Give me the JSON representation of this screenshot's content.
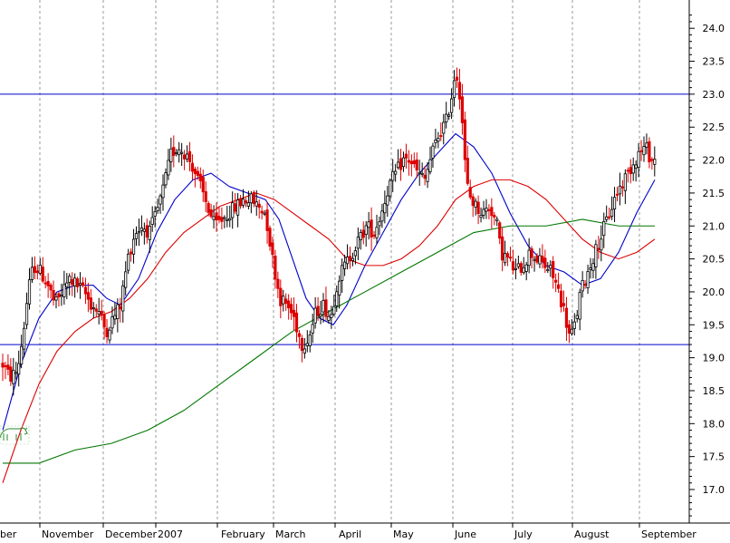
{
  "chart_data": {
    "type": "candlestick",
    "title": "",
    "xlabel": "",
    "ylabel": "",
    "ylim": [
      16.6,
      24.3
    ],
    "y_ticks": [
      17.0,
      17.5,
      18.0,
      18.5,
      19.0,
      19.5,
      20.0,
      20.5,
      21.0,
      21.5,
      22.0,
      22.5,
      23.0,
      23.5,
      24.0
    ],
    "y_axis_side": "right",
    "x_labels": [
      "ber",
      "November",
      "December",
      "2007",
      "February",
      "March",
      "April",
      "May",
      "June",
      "July",
      "August",
      "September"
    ],
    "grid": "vertical dotted at month boundaries",
    "horizontal_lines": [
      {
        "value": 23.0,
        "color": "#0000cc"
      },
      {
        "value": 19.2,
        "color": "#0000cc"
      }
    ],
    "anchors": [
      [
        0,
        18.9
      ],
      [
        8,
        18.7
      ],
      [
        16,
        18.8
      ],
      [
        22,
        19.3
      ],
      [
        28,
        20.0
      ],
      [
        34,
        20.4
      ],
      [
        42,
        20.3
      ],
      [
        50,
        20.1
      ],
      [
        58,
        19.8
      ],
      [
        66,
        20.0
      ],
      [
        74,
        20.2
      ],
      [
        82,
        20.1
      ],
      [
        90,
        20.0
      ],
      [
        98,
        19.8
      ],
      [
        106,
        19.7
      ],
      [
        114,
        19.4
      ],
      [
        122,
        19.6
      ],
      [
        130,
        19.8
      ],
      [
        138,
        20.5
      ],
      [
        146,
        20.9
      ],
      [
        154,
        21.0
      ],
      [
        162,
        20.9
      ],
      [
        170,
        21.2
      ],
      [
        178,
        21.6
      ],
      [
        186,
        22.1
      ],
      [
        194,
        22.2
      ],
      [
        202,
        22.1
      ],
      [
        210,
        21.9
      ],
      [
        218,
        21.6
      ],
      [
        226,
        21.3
      ],
      [
        234,
        21.0
      ],
      [
        242,
        21.1
      ],
      [
        250,
        21.2
      ],
      [
        258,
        21.3
      ],
      [
        266,
        21.4
      ],
      [
        274,
        21.4
      ],
      [
        282,
        21.3
      ],
      [
        290,
        21.2
      ],
      [
        298,
        20.5
      ],
      [
        306,
        19.9
      ],
      [
        314,
        19.8
      ],
      [
        322,
        19.6
      ],
      [
        330,
        19.2
      ],
      [
        338,
        19.3
      ],
      [
        346,
        19.7
      ],
      [
        354,
        19.8
      ],
      [
        362,
        19.6
      ],
      [
        370,
        20.2
      ],
      [
        378,
        20.4
      ],
      [
        386,
        20.6
      ],
      [
        394,
        20.8
      ],
      [
        402,
        21.0
      ],
      [
        410,
        20.9
      ],
      [
        418,
        21.2
      ],
      [
        426,
        21.6
      ],
      [
        434,
        21.8
      ],
      [
        442,
        22.0
      ],
      [
        450,
        22.0
      ],
      [
        458,
        21.8
      ],
      [
        466,
        21.7
      ],
      [
        474,
        22.1
      ],
      [
        482,
        22.4
      ],
      [
        490,
        22.6
      ],
      [
        496,
        23.0
      ],
      [
        500,
        23.4
      ],
      [
        506,
        22.9
      ],
      [
        510,
        22.0
      ],
      [
        514,
        21.5
      ],
      [
        522,
        21.3
      ],
      [
        530,
        21.2
      ],
      [
        538,
        21.3
      ],
      [
        546,
        21.0
      ],
      [
        550,
        20.6
      ],
      [
        558,
        20.5
      ],
      [
        566,
        20.3
      ],
      [
        574,
        20.4
      ],
      [
        582,
        20.6
      ],
      [
        590,
        20.5
      ],
      [
        598,
        20.4
      ],
      [
        606,
        20.3
      ],
      [
        614,
        20.0
      ],
      [
        620,
        19.7
      ],
      [
        626,
        19.3
      ],
      [
        632,
        19.5
      ],
      [
        638,
        20.0
      ],
      [
        646,
        20.3
      ],
      [
        654,
        20.6
      ],
      [
        662,
        20.9
      ],
      [
        670,
        21.2
      ],
      [
        678,
        21.5
      ],
      [
        686,
        21.7
      ],
      [
        694,
        21.9
      ],
      [
        702,
        22.1
      ],
      [
        710,
        22.2
      ],
      [
        716,
        22.0
      ],
      [
        722,
        22.0
      ]
    ],
    "moving_averages": [
      {
        "color": "#0000cc",
        "values": [
          [
            0,
            17.9
          ],
          [
            20,
            18.9
          ],
          [
            40,
            19.6
          ],
          [
            60,
            20.0
          ],
          [
            80,
            20.1
          ],
          [
            100,
            20.1
          ],
          [
            115,
            19.9
          ],
          [
            130,
            19.8
          ],
          [
            150,
            20.2
          ],
          [
            170,
            20.9
          ],
          [
            190,
            21.4
          ],
          [
            210,
            21.7
          ],
          [
            230,
            21.8
          ],
          [
            250,
            21.6
          ],
          [
            270,
            21.5
          ],
          [
            290,
            21.4
          ],
          [
            305,
            21.1
          ],
          [
            320,
            20.5
          ],
          [
            335,
            19.9
          ],
          [
            350,
            19.6
          ],
          [
            365,
            19.5
          ],
          [
            380,
            19.8
          ],
          [
            400,
            20.4
          ],
          [
            420,
            20.9
          ],
          [
            440,
            21.4
          ],
          [
            460,
            21.8
          ],
          [
            480,
            22.1
          ],
          [
            500,
            22.4
          ],
          [
            520,
            22.2
          ],
          [
            540,
            21.8
          ],
          [
            560,
            21.2
          ],
          [
            580,
            20.7
          ],
          [
            600,
            20.4
          ],
          [
            620,
            20.3
          ],
          [
            640,
            20.1
          ],
          [
            660,
            20.2
          ],
          [
            680,
            20.6
          ],
          [
            700,
            21.2
          ],
          [
            720,
            21.7
          ]
        ]
      },
      {
        "color": "#dd0000",
        "values": [
          [
            0,
            17.1
          ],
          [
            20,
            17.9
          ],
          [
            40,
            18.6
          ],
          [
            60,
            19.1
          ],
          [
            80,
            19.4
          ],
          [
            100,
            19.6
          ],
          [
            120,
            19.7
          ],
          [
            140,
            19.9
          ],
          [
            160,
            20.2
          ],
          [
            180,
            20.6
          ],
          [
            200,
            20.9
          ],
          [
            220,
            21.1
          ],
          [
            240,
            21.3
          ],
          [
            260,
            21.4
          ],
          [
            280,
            21.5
          ],
          [
            300,
            21.4
          ],
          [
            320,
            21.2
          ],
          [
            340,
            21.0
          ],
          [
            360,
            20.8
          ],
          [
            380,
            20.5
          ],
          [
            400,
            20.4
          ],
          [
            420,
            20.4
          ],
          [
            440,
            20.5
          ],
          [
            460,
            20.7
          ],
          [
            480,
            21.0
          ],
          [
            500,
            21.4
          ],
          [
            520,
            21.6
          ],
          [
            540,
            21.7
          ],
          [
            560,
            21.7
          ],
          [
            580,
            21.6
          ],
          [
            600,
            21.4
          ],
          [
            620,
            21.1
          ],
          [
            640,
            20.8
          ],
          [
            660,
            20.6
          ],
          [
            680,
            20.5
          ],
          [
            700,
            20.6
          ],
          [
            720,
            20.8
          ]
        ]
      },
      {
        "color": "#007700",
        "values": [
          [
            0,
            17.4
          ],
          [
            40,
            17.4
          ],
          [
            80,
            17.6
          ],
          [
            120,
            17.7
          ],
          [
            160,
            17.9
          ],
          [
            200,
            18.2
          ],
          [
            240,
            18.6
          ],
          [
            280,
            19.0
          ],
          [
            320,
            19.4
          ],
          [
            360,
            19.7
          ],
          [
            400,
            20.0
          ],
          [
            440,
            20.3
          ],
          [
            480,
            20.6
          ],
          [
            520,
            20.9
          ],
          [
            560,
            21.0
          ],
          [
            600,
            21.0
          ],
          [
            640,
            21.1
          ],
          [
            680,
            21.0
          ],
          [
            720,
            21.0
          ]
        ]
      }
    ]
  }
}
